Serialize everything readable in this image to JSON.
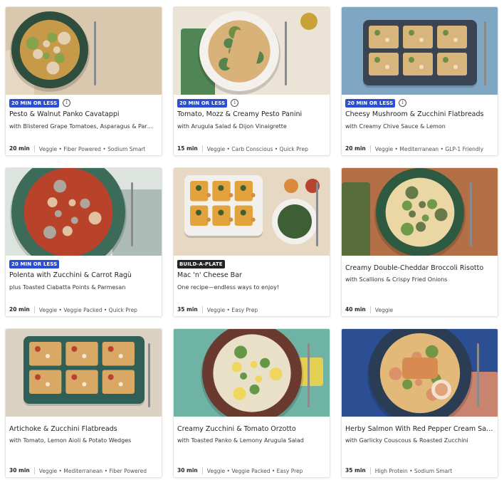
{
  "recipes": [
    {
      "badge": "20 MIN OR LESS",
      "badge_style": "blue",
      "title": "Pesto & Walnut Panko Cavatappi",
      "subtitle": "with Blistered Grape Tomatoes, Asparagus & Parmesan",
      "time": "20 min",
      "tags": "Veggie • Fiber Powered • Sodium Smart",
      "photo": {
        "bg": "#d9c7ae",
        "plate": "#2f4d3c",
        "food": "#c79a4a",
        "accent": "#7aa34a",
        "cloth": "#e8d9c5"
      }
    },
    {
      "badge": "20 MIN OR LESS",
      "badge_style": "blue",
      "title": "Tomato, Mozz & Creamy Pesto Panini",
      "subtitle": "with Arugula Salad & Dijon Vinaigrette",
      "time": "15 min",
      "tags": "Veggie • Carb Conscious • Quick Prep",
      "photo": {
        "bg": "#ebe3d6",
        "plate": "#f4f1ec",
        "food": "#d9b27a",
        "accent": "#5c8a3a",
        "cloth": "#3f7a48"
      }
    },
    {
      "badge": "20 MIN OR LESS",
      "badge_style": "blue",
      "title": "Cheesy Mushroom & Zucchini Flatbreads",
      "subtitle": "with Creamy Chive Sauce & Lemon",
      "time": "20 min",
      "tags": "Veggie • Mediterranean • GLP-1 Friendly",
      "photo": {
        "bg": "#7fa7c4",
        "plate": "#3b4452",
        "food": "#d8b57c",
        "accent": "#6d8f44",
        "cloth": "#f0e2c0"
      }
    },
    {
      "badge": "20 MIN OR LESS",
      "badge_style": "blue",
      "title": "Polenta with Zucchini & Carrot Ragù",
      "subtitle": "plus Toasted Ciabatta Points & Parmesan",
      "time": "20 min",
      "tags": "Veggie • Veggie Packed • Quick Prep",
      "photo": {
        "bg": "#dde4e0",
        "plate": "#3d6b5a",
        "food": "#b8432a",
        "accent": "#e8d8b5",
        "cloth": "#a9b7b2"
      }
    },
    {
      "badge": "BUILD-A-PLATE",
      "badge_style": "dark",
      "title": "Mac 'n' Cheese Bar",
      "subtitle": "One recipe—endless ways to enjoy!",
      "time": "35 min",
      "tags": "Veggie • Easy Prep",
      "photo": {
        "bg": "#e6d8c3",
        "plate": "#f2f0ec",
        "food": "#e3a33c",
        "accent": "#3e5e35",
        "cloth": "#d98a3c"
      }
    },
    {
      "badge": "",
      "badge_style": "none",
      "title": "Creamy Double-Cheddar Broccoli Risotto",
      "subtitle": "with Scallions & Crispy Fried Onions",
      "time": "40 min",
      "tags": "Veggie",
      "photo": {
        "bg": "#b36f45",
        "plate": "#2f5a42",
        "food": "#ead7a4",
        "accent": "#5b8f3a",
        "cloth": "#4f6b3a"
      }
    },
    {
      "badge": "",
      "badge_style": "none",
      "title": "Artichoke & Zucchini Flatbreads",
      "subtitle": "with Tomato, Lemon Aioli & Potato Wedges",
      "time": "30 min",
      "tags": "Veggie • Mediterranean • Fiber Powered",
      "photo": {
        "bg": "#dcd2c4",
        "plate": "#2f5f56",
        "food": "#d9a865",
        "accent": "#b8442e",
        "cloth": "#f2ead8"
      }
    },
    {
      "badge": "",
      "badge_style": "none",
      "title": "Creamy Zucchini & Tomato Orzotto",
      "subtitle": "with Toasted Panko & Lemony Arugula Salad",
      "time": "30 min",
      "tags": "Veggie • Veggie Packed • Easy Prep",
      "photo": {
        "bg": "#6fb3a5",
        "plate": "#6b3a2f",
        "food": "#e9e0c8",
        "accent": "#4f8a32",
        "cloth": "#f0d34a"
      }
    },
    {
      "badge": "",
      "badge_style": "none",
      "title": "Herby Salmon With Red Pepper Cream Sauce",
      "subtitle": "with Garlicky Couscous & Roasted Zucchini",
      "time": "35 min",
      "tags": "High Protein • Sodium Smart",
      "photo": {
        "bg": "#2c4f93",
        "plate": "#2b3d55",
        "food": "#e2b978",
        "accent": "#5f8f3c",
        "cloth": "#d98a6a"
      }
    }
  ]
}
